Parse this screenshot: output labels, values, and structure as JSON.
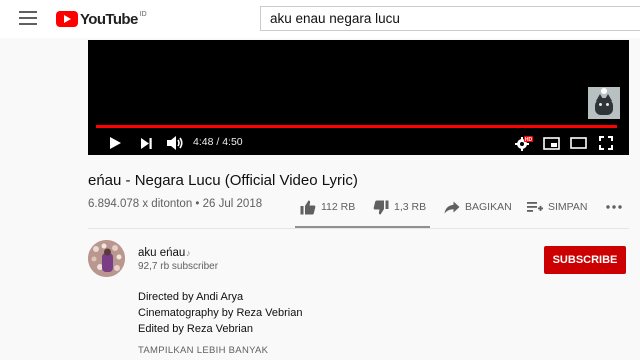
{
  "header": {
    "logo_text": "YouTube",
    "logo_country": "ID",
    "search_value": "aku enau negara lucu"
  },
  "player": {
    "time_current": "4:48",
    "time_separator": "/",
    "time_duration": "4:50",
    "time_display": "4:48 / 4:50",
    "progress_fraction": 0.993,
    "settings_badge": "HD",
    "icons": [
      "play-icon",
      "next-icon",
      "volume-icon",
      "settings-icon",
      "miniplayer-icon",
      "theater-icon",
      "fullscreen-icon"
    ]
  },
  "video": {
    "title": "eńau - Negara Lucu (Official Video Lyric)",
    "views_date": "6.894.078 x ditonton • 26 Jul 2018",
    "actions": {
      "like": "112 RB",
      "dislike": "1,3 RB",
      "share": "BAGIKAN",
      "save": "SIMPAN"
    }
  },
  "channel": {
    "name": "aku eńau",
    "subscribers": "92,7 rb subscriber",
    "subscribe_label": "SUBSCRIBE"
  },
  "description": {
    "lines": [
      "Directed by Andi Arya",
      "Cinematography by Reza Vebrian",
      "Edited by Reza Vebrian"
    ],
    "show_more": "TAMPILKAN LEBIH BANYAK"
  },
  "colors": {
    "brand_red": "#ff0000",
    "subscribe_red": "#cc0000",
    "progress_red": "#ff0000"
  }
}
